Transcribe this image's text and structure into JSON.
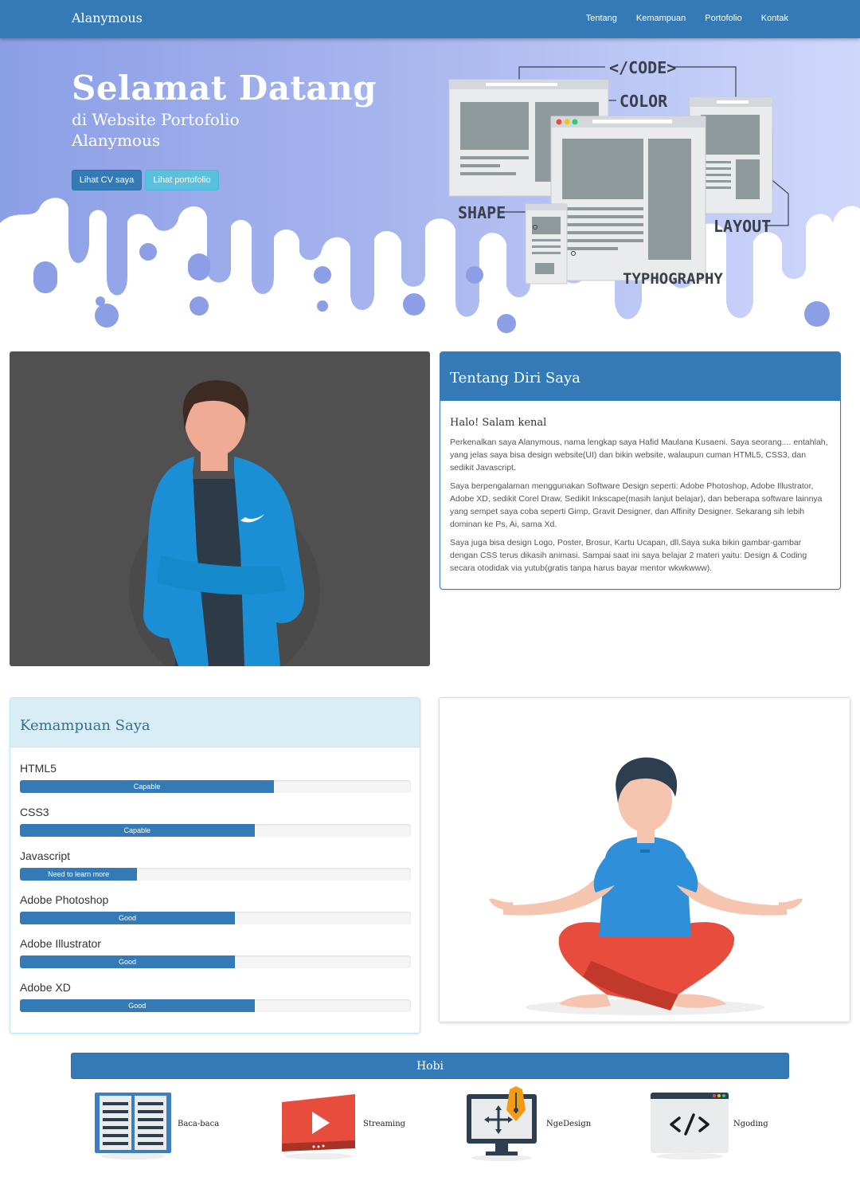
{
  "navbar": {
    "brand": "Alanymous",
    "links": [
      "Tentang",
      "Kemampuan",
      "Portofolio",
      "Kontak"
    ]
  },
  "hero": {
    "title": "Selamat Datang",
    "subtitle_lines": [
      "di Website Portofolio",
      "Alanymous"
    ],
    "buttons": {
      "cv": "Lihat CV saya",
      "portfolio": "Lihat portofolio"
    },
    "illustration_labels": [
      "</CODE>",
      "COLOR",
      "SHAPE",
      "LAYOUT",
      "TYPHOGRAPHY"
    ]
  },
  "about": {
    "title": "Tentang Diri Saya",
    "greeting": "Halo! Salam kenal",
    "paragraphs": [
      "Perkenalkan saya Alanymous, nama lengkap saya Hafid Maulana Kusaeni. Saya seorang.... entahlah, yang jelas saya bisa design website(UI) dan bikin website, walaupun cuman HTML5, CSS3, dan sedikit Javascript.",
      "Saya berpengalaman menggunakan Software Design seperti: Adobe Photoshop, Adobe Illustrator, Adobe XD, sedikit Corel Draw, Sedikit Inkscape(masih lanjut belajar), dan beberapa software lainnya yang sempet saya coba seperti Gimp, Gravit Designer, dan Affinity Designer. Sekarang sih lebih dominan ke Ps, Ai, sama Xd.",
      "Saya juga bisa design Logo, Poster, Brosur, Kartu Ucapan, dll.Saya suka bikin gambar-gambar dengan CSS terus dikasih animasi. Sampai saat ini saya belajar 2 materi yaitu: Design & Coding secara otodidak via yutub(gratis tanpa harus bayar mentor wkwkwww)."
    ]
  },
  "skills": {
    "title": "Kemampuan Saya",
    "items": [
      {
        "name": "HTML5",
        "label": "Capable",
        "percent": 65
      },
      {
        "name": "CSS3",
        "label": "Capable",
        "percent": 60
      },
      {
        "name": "Javascript",
        "label": "Need to learn more",
        "percent": 30
      },
      {
        "name": "Adobe Photoshop",
        "label": "Good",
        "percent": 55
      },
      {
        "name": "Adobe Illustrator",
        "label": "Good",
        "percent": 55
      },
      {
        "name": "Adobe XD",
        "label": "Good",
        "percent": 60
      }
    ]
  },
  "hobby": {
    "title": "Hobi",
    "items": [
      "Baca-baca",
      "Streaming",
      "NgeDesign",
      "Ngoding"
    ]
  },
  "colors": {
    "primary": "#337ab7",
    "info": "#5bc0de",
    "panel_info_bg": "#d9edf7",
    "hero_gradient_start": "#8c9fe6",
    "hero_gradient_end": "#cfd8fb"
  }
}
